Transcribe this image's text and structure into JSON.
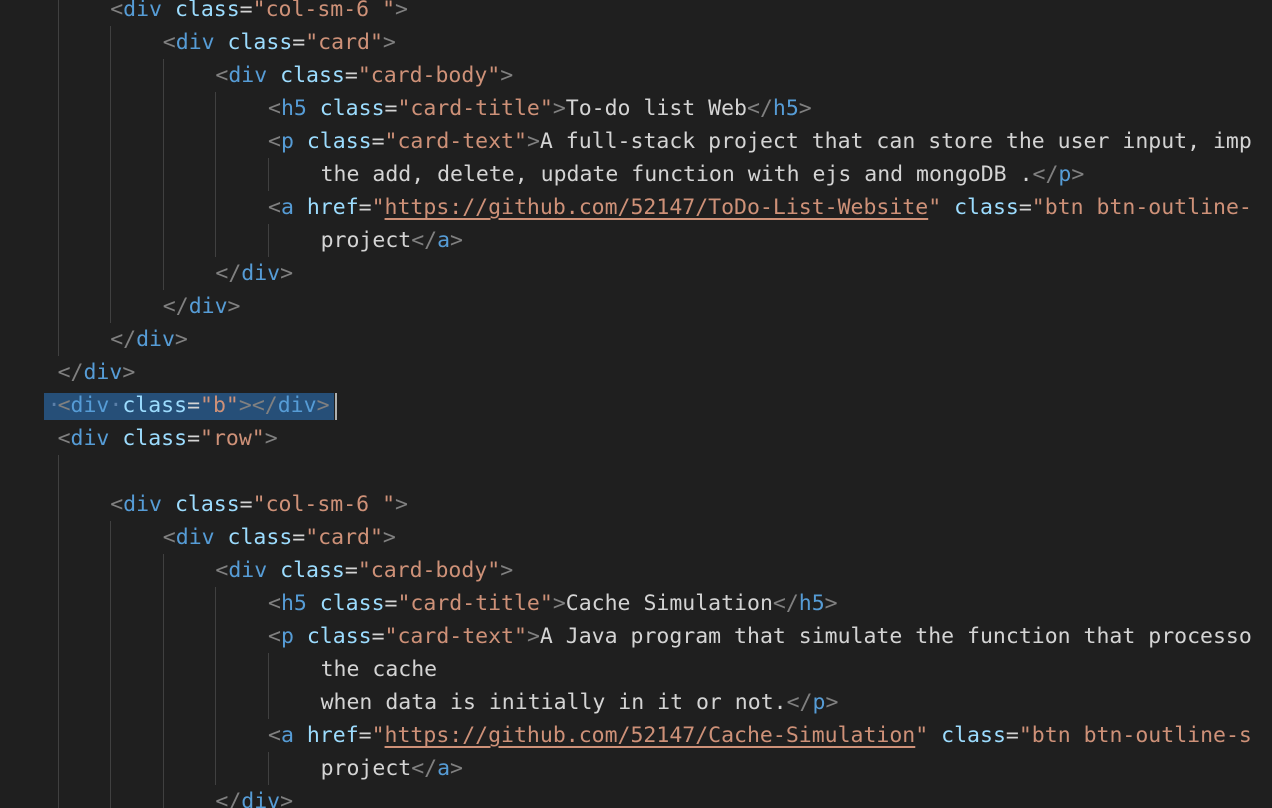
{
  "lines": [
    {
      "indent": 2,
      "tokens": [
        [
          "punc",
          "<"
        ],
        [
          "tag",
          "div"
        ],
        [
          "txt",
          " "
        ],
        [
          "attr",
          "class"
        ],
        [
          "eq",
          "="
        ],
        [
          "str",
          "\"col-sm-6 \""
        ],
        [
          "punc",
          ">"
        ]
      ]
    },
    {
      "indent": 3,
      "tokens": [
        [
          "punc",
          "<"
        ],
        [
          "tag",
          "div"
        ],
        [
          "txt",
          " "
        ],
        [
          "attr",
          "class"
        ],
        [
          "eq",
          "="
        ],
        [
          "str",
          "\"card\""
        ],
        [
          "punc",
          ">"
        ]
      ]
    },
    {
      "indent": 4,
      "tokens": [
        [
          "punc",
          "<"
        ],
        [
          "tag",
          "div"
        ],
        [
          "txt",
          " "
        ],
        [
          "attr",
          "class"
        ],
        [
          "eq",
          "="
        ],
        [
          "str",
          "\"card-body\""
        ],
        [
          "punc",
          ">"
        ]
      ]
    },
    {
      "indent": 5,
      "tokens": [
        [
          "punc",
          "<"
        ],
        [
          "tag",
          "h5"
        ],
        [
          "txt",
          " "
        ],
        [
          "attr",
          "class"
        ],
        [
          "eq",
          "="
        ],
        [
          "str",
          "\"card-title\""
        ],
        [
          "punc",
          ">"
        ],
        [
          "txt",
          "To-do list Web"
        ],
        [
          "punc",
          "</"
        ],
        [
          "tag",
          "h5"
        ],
        [
          "punc",
          ">"
        ]
      ]
    },
    {
      "indent": 5,
      "tokens": [
        [
          "punc",
          "<"
        ],
        [
          "tag",
          "p"
        ],
        [
          "txt",
          " "
        ],
        [
          "attr",
          "class"
        ],
        [
          "eq",
          "="
        ],
        [
          "str",
          "\"card-text\""
        ],
        [
          "punc",
          ">"
        ],
        [
          "txt",
          "A full-stack project that can store the user input, imp"
        ]
      ]
    },
    {
      "indent": 6,
      "tokens": [
        [
          "txt",
          "the add, delete, update function with ejs and mongoDB ."
        ],
        [
          "punc",
          "</"
        ],
        [
          "tag",
          "p"
        ],
        [
          "punc",
          ">"
        ]
      ]
    },
    {
      "indent": 5,
      "tokens": [
        [
          "punc",
          "<"
        ],
        [
          "tag",
          "a"
        ],
        [
          "txt",
          " "
        ],
        [
          "attr",
          "href"
        ],
        [
          "eq",
          "="
        ],
        [
          "str",
          "\""
        ],
        [
          "link",
          "https://github.com/52147/ToDo-List-Website"
        ],
        [
          "str",
          "\""
        ],
        [
          "txt",
          " "
        ],
        [
          "attr",
          "class"
        ],
        [
          "eq",
          "="
        ],
        [
          "str",
          "\"btn btn-outline-"
        ]
      ]
    },
    {
      "indent": 6,
      "tokens": [
        [
          "txt",
          "project"
        ],
        [
          "punc",
          "</"
        ],
        [
          "tag",
          "a"
        ],
        [
          "punc",
          ">"
        ]
      ]
    },
    {
      "indent": 4,
      "tokens": [
        [
          "punc",
          "</"
        ],
        [
          "tag",
          "div"
        ],
        [
          "punc",
          ">"
        ]
      ]
    },
    {
      "indent": 3,
      "tokens": [
        [
          "punc",
          "</"
        ],
        [
          "tag",
          "div"
        ],
        [
          "punc",
          ">"
        ]
      ]
    },
    {
      "indent": 2,
      "tokens": [
        [
          "punc",
          "</"
        ],
        [
          "tag",
          "div"
        ],
        [
          "punc",
          ">"
        ]
      ]
    },
    {
      "indent": 1,
      "tokens": [
        [
          "punc",
          "</"
        ],
        [
          "tag",
          "div"
        ],
        [
          "punc",
          ">"
        ]
      ]
    },
    {
      "indent": 1,
      "selected": true,
      "tokens": [
        [
          "punc",
          "<"
        ],
        [
          "tag",
          "div"
        ],
        [
          "ws",
          "·"
        ],
        [
          "attr",
          "class"
        ],
        [
          "eq",
          "="
        ],
        [
          "str",
          "\"b\""
        ],
        [
          "punc",
          "></"
        ],
        [
          "tag",
          "div"
        ],
        [
          "punc",
          ">"
        ]
      ]
    },
    {
      "indent": 1,
      "tokens": [
        [
          "punc",
          "<"
        ],
        [
          "tag",
          "div"
        ],
        [
          "txt",
          " "
        ],
        [
          "attr",
          "class"
        ],
        [
          "eq",
          "="
        ],
        [
          "str",
          "\"row\""
        ],
        [
          "punc",
          ">"
        ]
      ]
    },
    {
      "indent": 1,
      "tokens": []
    },
    {
      "indent": 2,
      "tokens": [
        [
          "punc",
          "<"
        ],
        [
          "tag",
          "div"
        ],
        [
          "txt",
          " "
        ],
        [
          "attr",
          "class"
        ],
        [
          "eq",
          "="
        ],
        [
          "str",
          "\"col-sm-6 \""
        ],
        [
          "punc",
          ">"
        ]
      ]
    },
    {
      "indent": 3,
      "tokens": [
        [
          "punc",
          "<"
        ],
        [
          "tag",
          "div"
        ],
        [
          "txt",
          " "
        ],
        [
          "attr",
          "class"
        ],
        [
          "eq",
          "="
        ],
        [
          "str",
          "\"card\""
        ],
        [
          "punc",
          ">"
        ]
      ]
    },
    {
      "indent": 4,
      "tokens": [
        [
          "punc",
          "<"
        ],
        [
          "tag",
          "div"
        ],
        [
          "txt",
          " "
        ],
        [
          "attr",
          "class"
        ],
        [
          "eq",
          "="
        ],
        [
          "str",
          "\"card-body\""
        ],
        [
          "punc",
          ">"
        ]
      ]
    },
    {
      "indent": 5,
      "tokens": [
        [
          "punc",
          "<"
        ],
        [
          "tag",
          "h5"
        ],
        [
          "txt",
          " "
        ],
        [
          "attr",
          "class"
        ],
        [
          "eq",
          "="
        ],
        [
          "str",
          "\"card-title\""
        ],
        [
          "punc",
          ">"
        ],
        [
          "txt",
          "Cache Simulation"
        ],
        [
          "punc",
          "</"
        ],
        [
          "tag",
          "h5"
        ],
        [
          "punc",
          ">"
        ]
      ]
    },
    {
      "indent": 5,
      "tokens": [
        [
          "punc",
          "<"
        ],
        [
          "tag",
          "p"
        ],
        [
          "txt",
          " "
        ],
        [
          "attr",
          "class"
        ],
        [
          "eq",
          "="
        ],
        [
          "str",
          "\"card-text\""
        ],
        [
          "punc",
          ">"
        ],
        [
          "txt",
          "A Java program that simulate the function that processo"
        ]
      ]
    },
    {
      "indent": 6,
      "tokens": [
        [
          "txt",
          "the cache"
        ]
      ]
    },
    {
      "indent": 6,
      "tokens": [
        [
          "txt",
          "when data is initially in it or not."
        ],
        [
          "punc",
          "</"
        ],
        [
          "tag",
          "p"
        ],
        [
          "punc",
          ">"
        ]
      ]
    },
    {
      "indent": 5,
      "tokens": [
        [
          "punc",
          "<"
        ],
        [
          "tag",
          "a"
        ],
        [
          "txt",
          " "
        ],
        [
          "attr",
          "href"
        ],
        [
          "eq",
          "="
        ],
        [
          "str",
          "\""
        ],
        [
          "link",
          "https://github.com/52147/Cache-Simulation"
        ],
        [
          "str",
          "\""
        ],
        [
          "txt",
          " "
        ],
        [
          "attr",
          "class"
        ],
        [
          "eq",
          "="
        ],
        [
          "str",
          "\"btn btn-outline-s"
        ]
      ]
    },
    {
      "indent": 6,
      "tokens": [
        [
          "txt",
          "project"
        ],
        [
          "punc",
          "</"
        ],
        [
          "tag",
          "a"
        ],
        [
          "punc",
          ">"
        ]
      ]
    },
    {
      "indent": 4,
      "tokens": [
        [
          "punc",
          "</"
        ],
        [
          "tag",
          "div"
        ],
        [
          "punc",
          ">"
        ]
      ]
    }
  ],
  "colors": {
    "background": "#1f1f1f",
    "tag": "#569cd6",
    "attribute": "#9cdcfe",
    "string": "#ce9178",
    "text": "#d4d4d4",
    "punctuation": "#808080",
    "selection": "#264f78",
    "indent_guide": "#404040"
  }
}
